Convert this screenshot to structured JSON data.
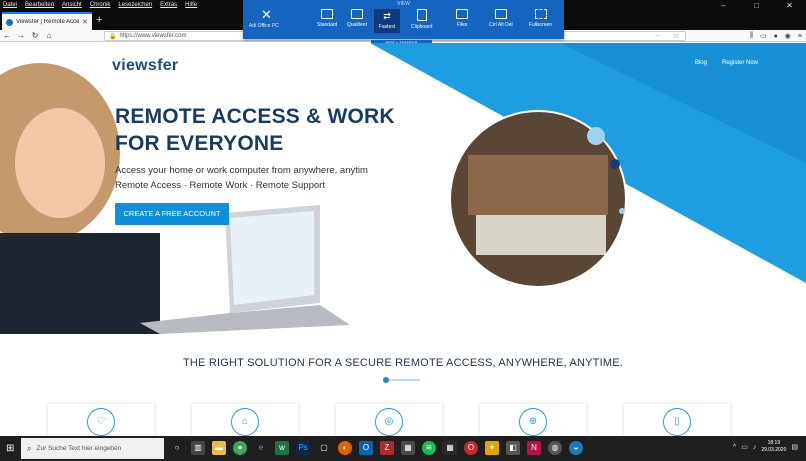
{
  "menu": [
    "Datei",
    "Bearbeiten",
    "Ansicht",
    "Chronik",
    "Lesezeichen",
    "Extras",
    "Hilfe"
  ],
  "tab_title": "Viewsfer | Remote Access Solu",
  "url": "https://www.viewsfer.com",
  "remote_toolbar": {
    "header": "VIEW",
    "close_label": "Adi Office PC",
    "buttons": [
      {
        "label": "Standard",
        "icon": "monitor-icon"
      },
      {
        "label": "Qualiteet",
        "icon": "image-icon"
      },
      {
        "label": "Fastest",
        "icon": "arrows-icon"
      },
      {
        "label": "Clipboard",
        "icon": "clipboard-icon"
      },
      {
        "label": "Files",
        "icon": "folder-icon"
      },
      {
        "label": "Ctrl Alt Del",
        "icon": "keyboard-icon"
      },
      {
        "label": "Fullscreen",
        "icon": "expand-icon"
      }
    ],
    "hide_label": "HIDE ^ TASKBAR"
  },
  "site": {
    "logo": "viewsfer",
    "nav": [
      "Blog",
      "Register Now"
    ],
    "hero_title_1": "REMOTE ACCESS & WORK",
    "hero_title_2": "FOR EVERYONE",
    "hero_sub_1": "Access your home or work computer from anywhere, anytim",
    "hero_sub_2": "Remote Access · Remote Work · Remote Support",
    "cta": "CREATE A FREE ACCOUNT",
    "section_title": "THE RIGHT SOLUTION FOR A SECURE REMOTE ACCESS, ANYWHERE, ANYTIME.",
    "card_icons": [
      "heart-icon",
      "lock-icon",
      "globe-icon",
      "support-icon",
      "mobile-icon"
    ]
  },
  "taskbar": {
    "search_placeholder": "Zur Suche Text hier eingeben",
    "time": "18:19",
    "date": "29.03.2020"
  },
  "colors": {
    "accent": "#1565c0",
    "hero_blue": "#1e9ee0",
    "cta": "#0e8fd9"
  }
}
